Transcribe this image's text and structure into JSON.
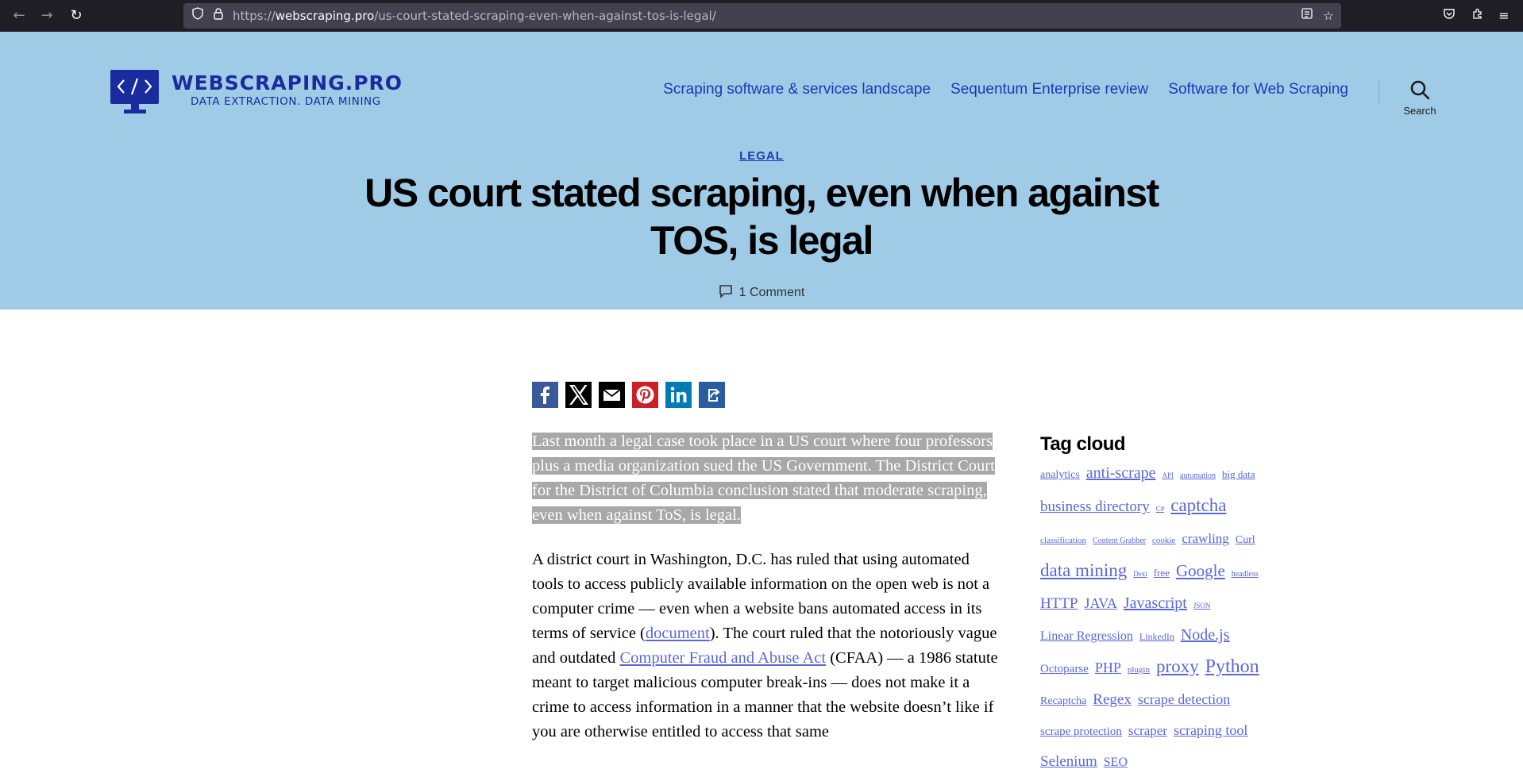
{
  "browser": {
    "url_scheme": "https://",
    "url_host": "webscraping.pro",
    "url_path": "/us-court-stated-scraping-even-when-against-tos-is-legal/"
  },
  "site": {
    "name": "WEBSCRAPING.PRO",
    "tagline": "DATA EXTRACTION. DATA MINING",
    "nav": [
      {
        "label": "Scraping software & services landscape"
      },
      {
        "label": "Sequentum Enterprise review"
      },
      {
        "label": "Software for Web Scraping"
      }
    ],
    "search_label": "Search"
  },
  "post": {
    "category": "LEGAL",
    "title": "US court stated scraping, even when against TOS, is legal",
    "comments": "1 Comment",
    "lead": "Last month a legal case took place in a US court where four professors plus a media organization sued the US Government. The District Court for the District of Columbia conclusion stated that moderate scraping, even when against ToS, is legal.",
    "body_1": "A district court in Washington, D.C. has ruled that using automated tools to access publicly available information on the open web is not a computer crime — even when a website bans automated access in its terms of service (",
    "link_document": "document",
    "body_2": "). The court ruled that the notoriously vague and outdated ",
    "link_cfaa": "Computer Fraud and Abuse Act",
    "body_3": " (CFAA) — a 1986 statute meant to target malicious computer break-ins — does not make it a crime to access information in a manner that the website doesn’t like if you are otherwise entitled to access that same"
  },
  "share": [
    {
      "name": "facebook",
      "color": "#3b5998"
    },
    {
      "name": "x",
      "color": "#000000"
    },
    {
      "name": "email",
      "color": "#000000"
    },
    {
      "name": "pinterest",
      "color": "#cb2027"
    },
    {
      "name": "linkedin",
      "color": "#007bb5"
    },
    {
      "name": "share",
      "color": "#2a5d9f"
    }
  ],
  "sidebar": {
    "widget_title": "Tag cloud",
    "tags": [
      {
        "label": "analytics",
        "size": 14
      },
      {
        "label": "anti-scrape",
        "size": 20
      },
      {
        "label": "API",
        "size": 9
      },
      {
        "label": "automation",
        "size": 10
      },
      {
        "label": "big data",
        "size": 13
      },
      {
        "label": "business directory",
        "size": 19
      },
      {
        "label": "C#",
        "size": 9
      },
      {
        "label": "captcha",
        "size": 23
      },
      {
        "label": "classification",
        "size": 11
      },
      {
        "label": "Content Grabber",
        "size": 10
      },
      {
        "label": "cookie",
        "size": 11
      },
      {
        "label": "crawling",
        "size": 17
      },
      {
        "label": "Curl",
        "size": 14
      },
      {
        "label": "data mining",
        "size": 23
      },
      {
        "label": "Dexi",
        "size": 9
      },
      {
        "label": "free",
        "size": 13
      },
      {
        "label": "Google",
        "size": 21
      },
      {
        "label": "headless",
        "size": 10
      },
      {
        "label": "HTTP",
        "size": 19
      },
      {
        "label": "JAVA",
        "size": 18
      },
      {
        "label": "Javascript",
        "size": 20
      },
      {
        "label": "JSON",
        "size": 9
      },
      {
        "label": "Linear Regression",
        "size": 16
      },
      {
        "label": "LinkedIn",
        "size": 12
      },
      {
        "label": "Node.js",
        "size": 20
      },
      {
        "label": "Octoparse",
        "size": 15
      },
      {
        "label": "PHP",
        "size": 18
      },
      {
        "label": "plugin",
        "size": 11
      },
      {
        "label": "proxy",
        "size": 23
      },
      {
        "label": "Python",
        "size": 24
      },
      {
        "label": "Recaptcha",
        "size": 14
      },
      {
        "label": "Regex",
        "size": 19
      },
      {
        "label": "scrape detection",
        "size": 18
      },
      {
        "label": "scrape protection",
        "size": 15
      },
      {
        "label": "scraper",
        "size": 17
      },
      {
        "label": "scraping tool",
        "size": 18
      },
      {
        "label": "Selenium",
        "size": 19
      },
      {
        "label": "SEO",
        "size": 16
      }
    ]
  },
  "colors": {
    "header_bg": "#a0cbe6",
    "brand": "#1a2b9e",
    "link": "#5a67d8",
    "nav_link": "#1a3ab8"
  }
}
